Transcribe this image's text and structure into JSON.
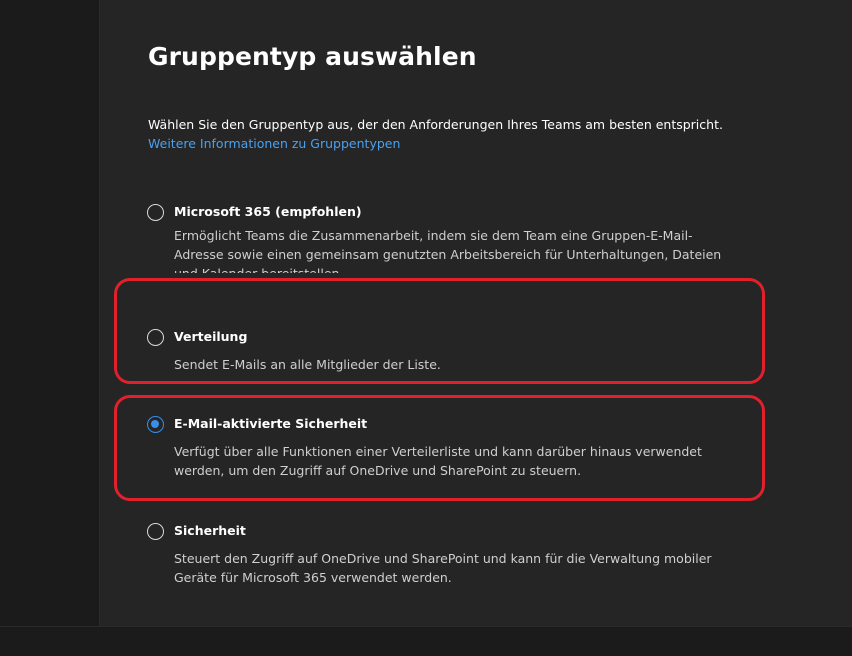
{
  "header": {
    "title": "Gruppentyp auswählen"
  },
  "intro": {
    "description": "Wählen Sie den Gruppentyp aus, der den Anforderungen Ihres Teams am besten entspricht.",
    "learn_more_link": "Weitere Informationen zu Gruppentypen"
  },
  "options": [
    {
      "label": "Microsoft 365 (empfohlen)",
      "description": "Ermöglicht Teams die Zusammenarbeit, indem sie dem Team eine Gruppen-E-Mail-Adresse sowie einen gemeinsam genutzten Arbeitsbereich für Unterhaltungen, Dateien und Kalender bereitstellen.",
      "selected": false
    },
    {
      "label": "Verteilung",
      "description": "Sendet E-Mails an alle Mitglieder der Liste.",
      "selected": false
    },
    {
      "label": "E-Mail-aktivierte Sicherheit",
      "description": "Verfügt über alle Funktionen einer Verteilerliste und kann darüber hinaus verwendet werden, um den Zugriff auf OneDrive und SharePoint zu steuern.",
      "selected": true
    },
    {
      "label": "Sicherheit",
      "description": "Steuert den Zugriff auf OneDrive und SharePoint und kann für die Verwaltung mobiler Geräte für Microsoft 365 verwendet werden.",
      "selected": false
    }
  ],
  "colors": {
    "accent": "#3a8ee6",
    "link": "#4aa0f0",
    "highlight": "#e0202a",
    "panel_background": "#252525"
  }
}
